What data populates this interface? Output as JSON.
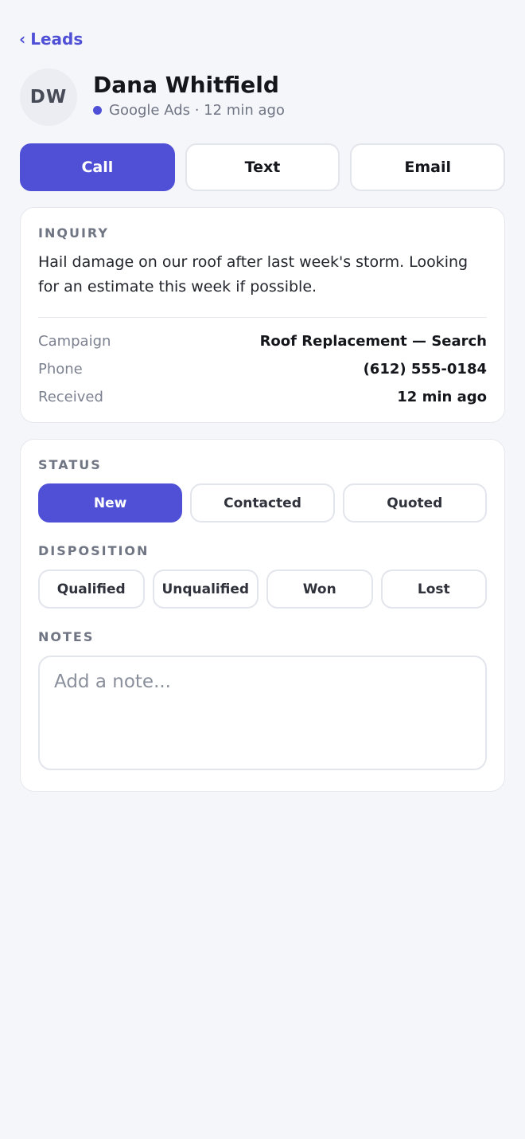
{
  "nav": {
    "back_chevron": "‹",
    "back_label": "Leads"
  },
  "lead": {
    "initials": "DW",
    "name": "Dana Whitfield",
    "source": "Google Ads · 12 min ago",
    "source_dot_color": "#4f50d6"
  },
  "actions": {
    "call": "Call",
    "text": "Text",
    "email": "Email"
  },
  "inquiry": {
    "label": "INQUIRY",
    "message": "Hail damage on our roof after last week's storm. Looking for an estimate this week if possible.",
    "details": [
      {
        "key": "Campaign",
        "value": "Roof Replacement — Search"
      },
      {
        "key": "Phone",
        "value": "(612) 555-0184"
      },
      {
        "key": "Received",
        "value": "12 min ago"
      }
    ]
  },
  "status": {
    "label": "STATUS",
    "options": [
      "New",
      "Contacted",
      "Quoted"
    ],
    "selected": "New"
  },
  "disposition": {
    "label": "DISPOSITION",
    "options": [
      "Qualified",
      "Unqualified",
      "Won",
      "Lost"
    ]
  },
  "notes": {
    "label": "NOTES",
    "placeholder": "Add a note...",
    "value": ""
  },
  "colors": {
    "accent": "#4f50d6",
    "background": "#f5f6fa"
  }
}
